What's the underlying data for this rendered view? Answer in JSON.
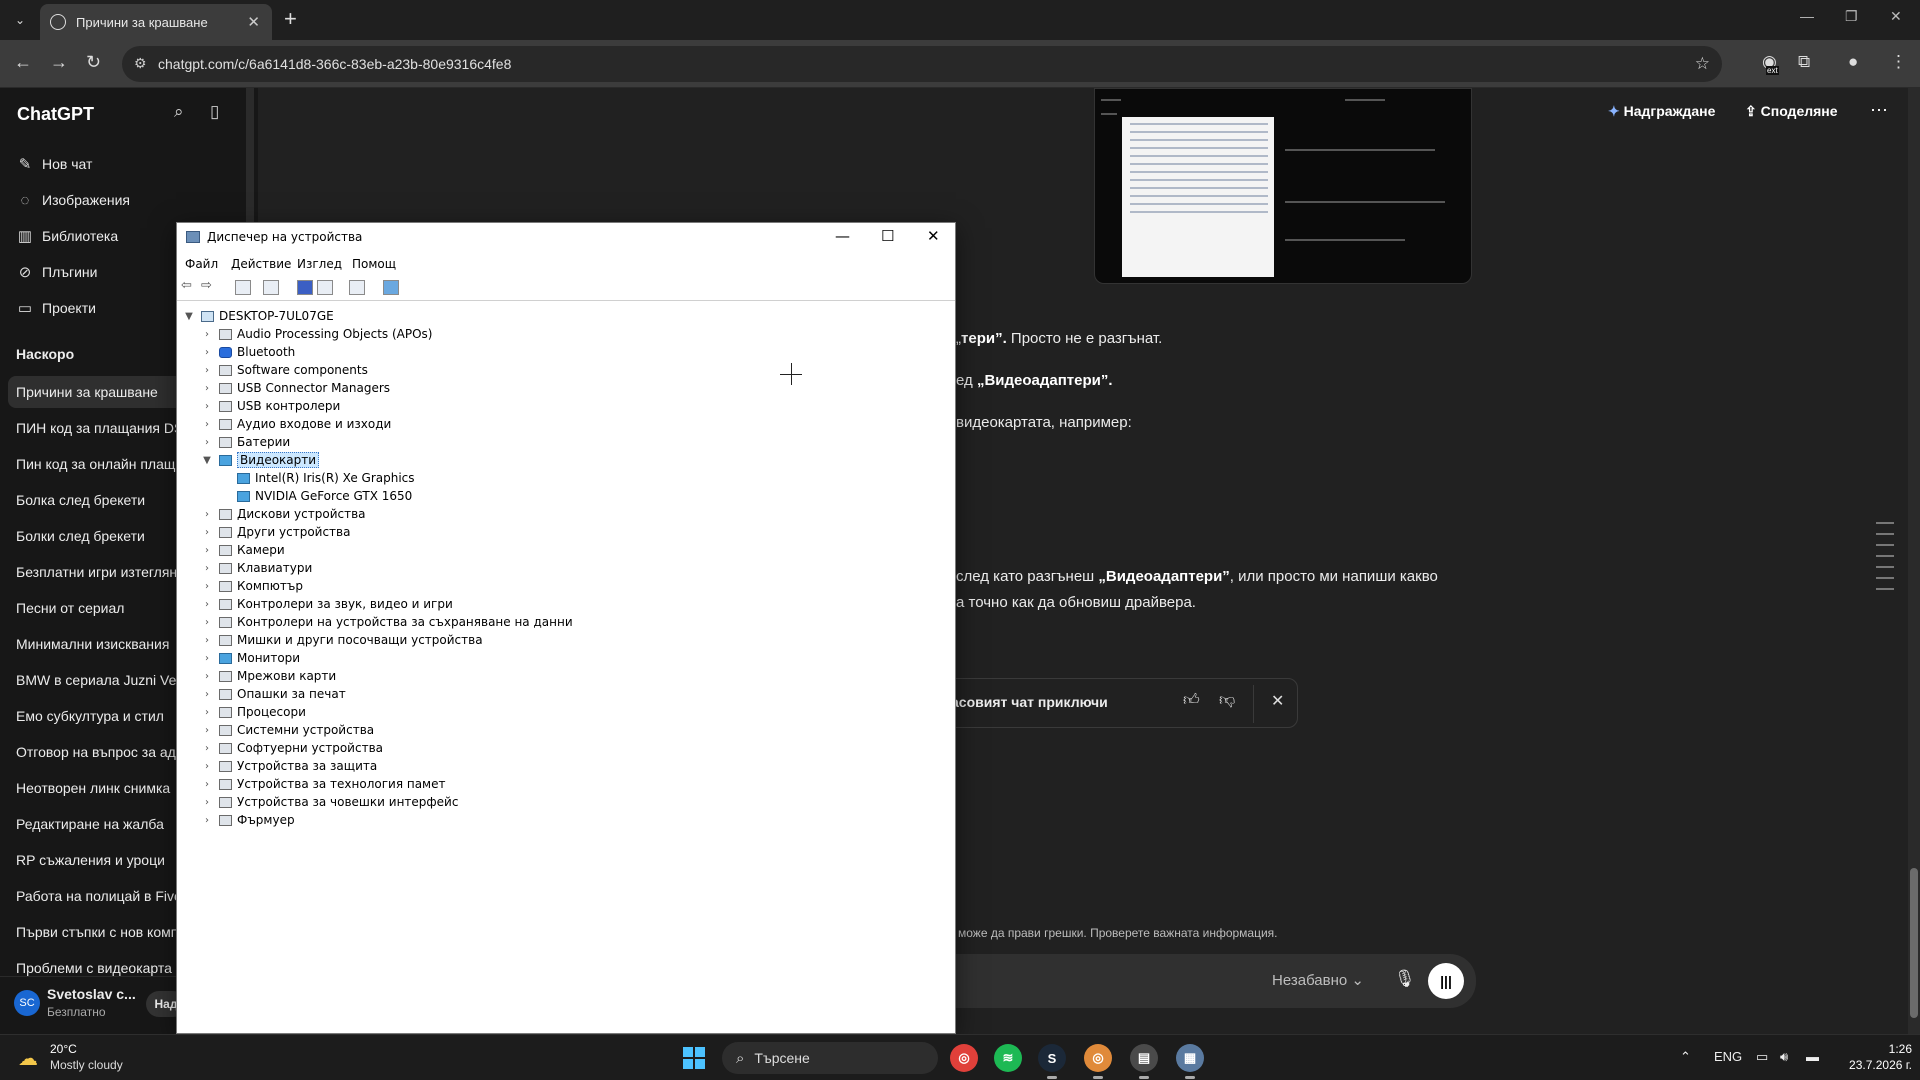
{
  "browser": {
    "tab_title": "Причини за крашване",
    "url": "chatgpt.com/c/6a6141d8-366c-83eb-a23b-80e9316c4fe8",
    "ext_badge": "ext"
  },
  "sidebar": {
    "logo": "ChatGPT",
    "menu": [
      {
        "icon": "edit-icon",
        "label": "Нов чат"
      },
      {
        "icon": "image-icon",
        "label": "Изображения"
      },
      {
        "icon": "library-icon",
        "label": "Библиотека"
      },
      {
        "icon": "plugins-icon",
        "label": "Плъгини"
      },
      {
        "icon": "folder-icon",
        "label": "Проекти"
      }
    ],
    "recent_heading": "Наскоро",
    "history": [
      "Причини за крашване",
      "ПИН код за плащания DS",
      "Пин код за онлайн плащ",
      "Болка след брекети",
      "Болки след брекети",
      "Безплатни игри изтеглян",
      "Песни от сериал",
      "Минимални изисквания",
      "BMW в сериала Juzni Vet",
      "Емо субкултура и стил",
      "Отговор на въпрос за ад",
      "Неотворен линк снимка",
      "Редактиране на жалба",
      "RP съжаления и уроци",
      "Работа на полицай в Five",
      "Първи стъпки с нов комп",
      "Проблеми с видеокарта"
    ],
    "user": {
      "initials": "SC",
      "name": "Svetoslav c...",
      "plan": "Безплатно",
      "upgrade_short": "Над"
    }
  },
  "header": {
    "upgrade": "Надграждане",
    "share": "Споделяне"
  },
  "chat": {
    "line1_bold": "тери”.",
    "line1_rest": " Просто не е разгънат.",
    "line2_pre": "ед ",
    "line2_bold": "„Видеоадаптери”.",
    "line3": " видеокартата, например:",
    "line4_pre": " след като разгънеш ",
    "line4_bold": "„Видеоадаптери”",
    "line4_rest": ", или просто ми напиши какво",
    "line5": "а точно как да обновиш драйвера.",
    "feedback": "асовият чат приключи",
    "disclaimer": "може да прави грешки. Проверете важната информация.",
    "model": "Незабавно"
  },
  "devmgr": {
    "title": "Диспечер на устройства",
    "menu": [
      "Файл",
      "Действие",
      "Изглед",
      "Помощ"
    ],
    "root": "DESKTOP-7UL07GE",
    "categories": [
      {
        "label": "Audio Processing Objects (APOs)",
        "icon": "audio-icon"
      },
      {
        "label": "Bluetooth",
        "icon": "bluetooth-icon"
      },
      {
        "label": "Software components",
        "icon": "component-icon"
      },
      {
        "label": "USB Connector Managers",
        "icon": "usb-icon"
      },
      {
        "label": "USB контролери",
        "icon": "usb-icon"
      },
      {
        "label": "Аудио входове и изходи",
        "icon": "audio-icon"
      },
      {
        "label": "Батерии",
        "icon": "battery-icon"
      },
      {
        "label": "Видеокарти",
        "icon": "display-adapter-icon",
        "expanded": true,
        "selected": true,
        "children": [
          "Intel(R) Iris(R) Xe Graphics",
          "NVIDIA GeForce GTX 1650"
        ]
      },
      {
        "label": "Дискови устройства",
        "icon": "disk-icon"
      },
      {
        "label": "Други устройства",
        "icon": "unknown-device-icon"
      },
      {
        "label": "Камери",
        "icon": "camera-icon"
      },
      {
        "label": "Клавиатури",
        "icon": "keyboard-icon"
      },
      {
        "label": "Компютър",
        "icon": "computer-icon"
      },
      {
        "label": "Контролери за звук, видео и игри",
        "icon": "sound-icon"
      },
      {
        "label": "Контролери на устройства за съхраняване на данни",
        "icon": "storage-icon"
      },
      {
        "label": "Мишки и други посочващи устройства",
        "icon": "mouse-icon"
      },
      {
        "label": "Монитори",
        "icon": "monitor-icon"
      },
      {
        "label": "Мрежови карти",
        "icon": "network-icon"
      },
      {
        "label": "Опашки за печат",
        "icon": "printer-icon"
      },
      {
        "label": "Процесори",
        "icon": "cpu-icon"
      },
      {
        "label": "Системни устройства",
        "icon": "system-icon"
      },
      {
        "label": "Софтуерни устройства",
        "icon": "software-device-icon"
      },
      {
        "label": "Устройства за защита",
        "icon": "security-icon"
      },
      {
        "label": "Устройства за технология памет",
        "icon": "memory-icon"
      },
      {
        "label": "Устройства за човешки интерфейс",
        "icon": "hid-icon"
      },
      {
        "label": "Фърмуер",
        "icon": "firmware-icon"
      }
    ]
  },
  "taskbar": {
    "temp": "20°C",
    "weather": "Mostly cloudy",
    "search": "Търсене",
    "lang": "ENG",
    "time": "1:26",
    "date": "23.7.2026 г."
  }
}
